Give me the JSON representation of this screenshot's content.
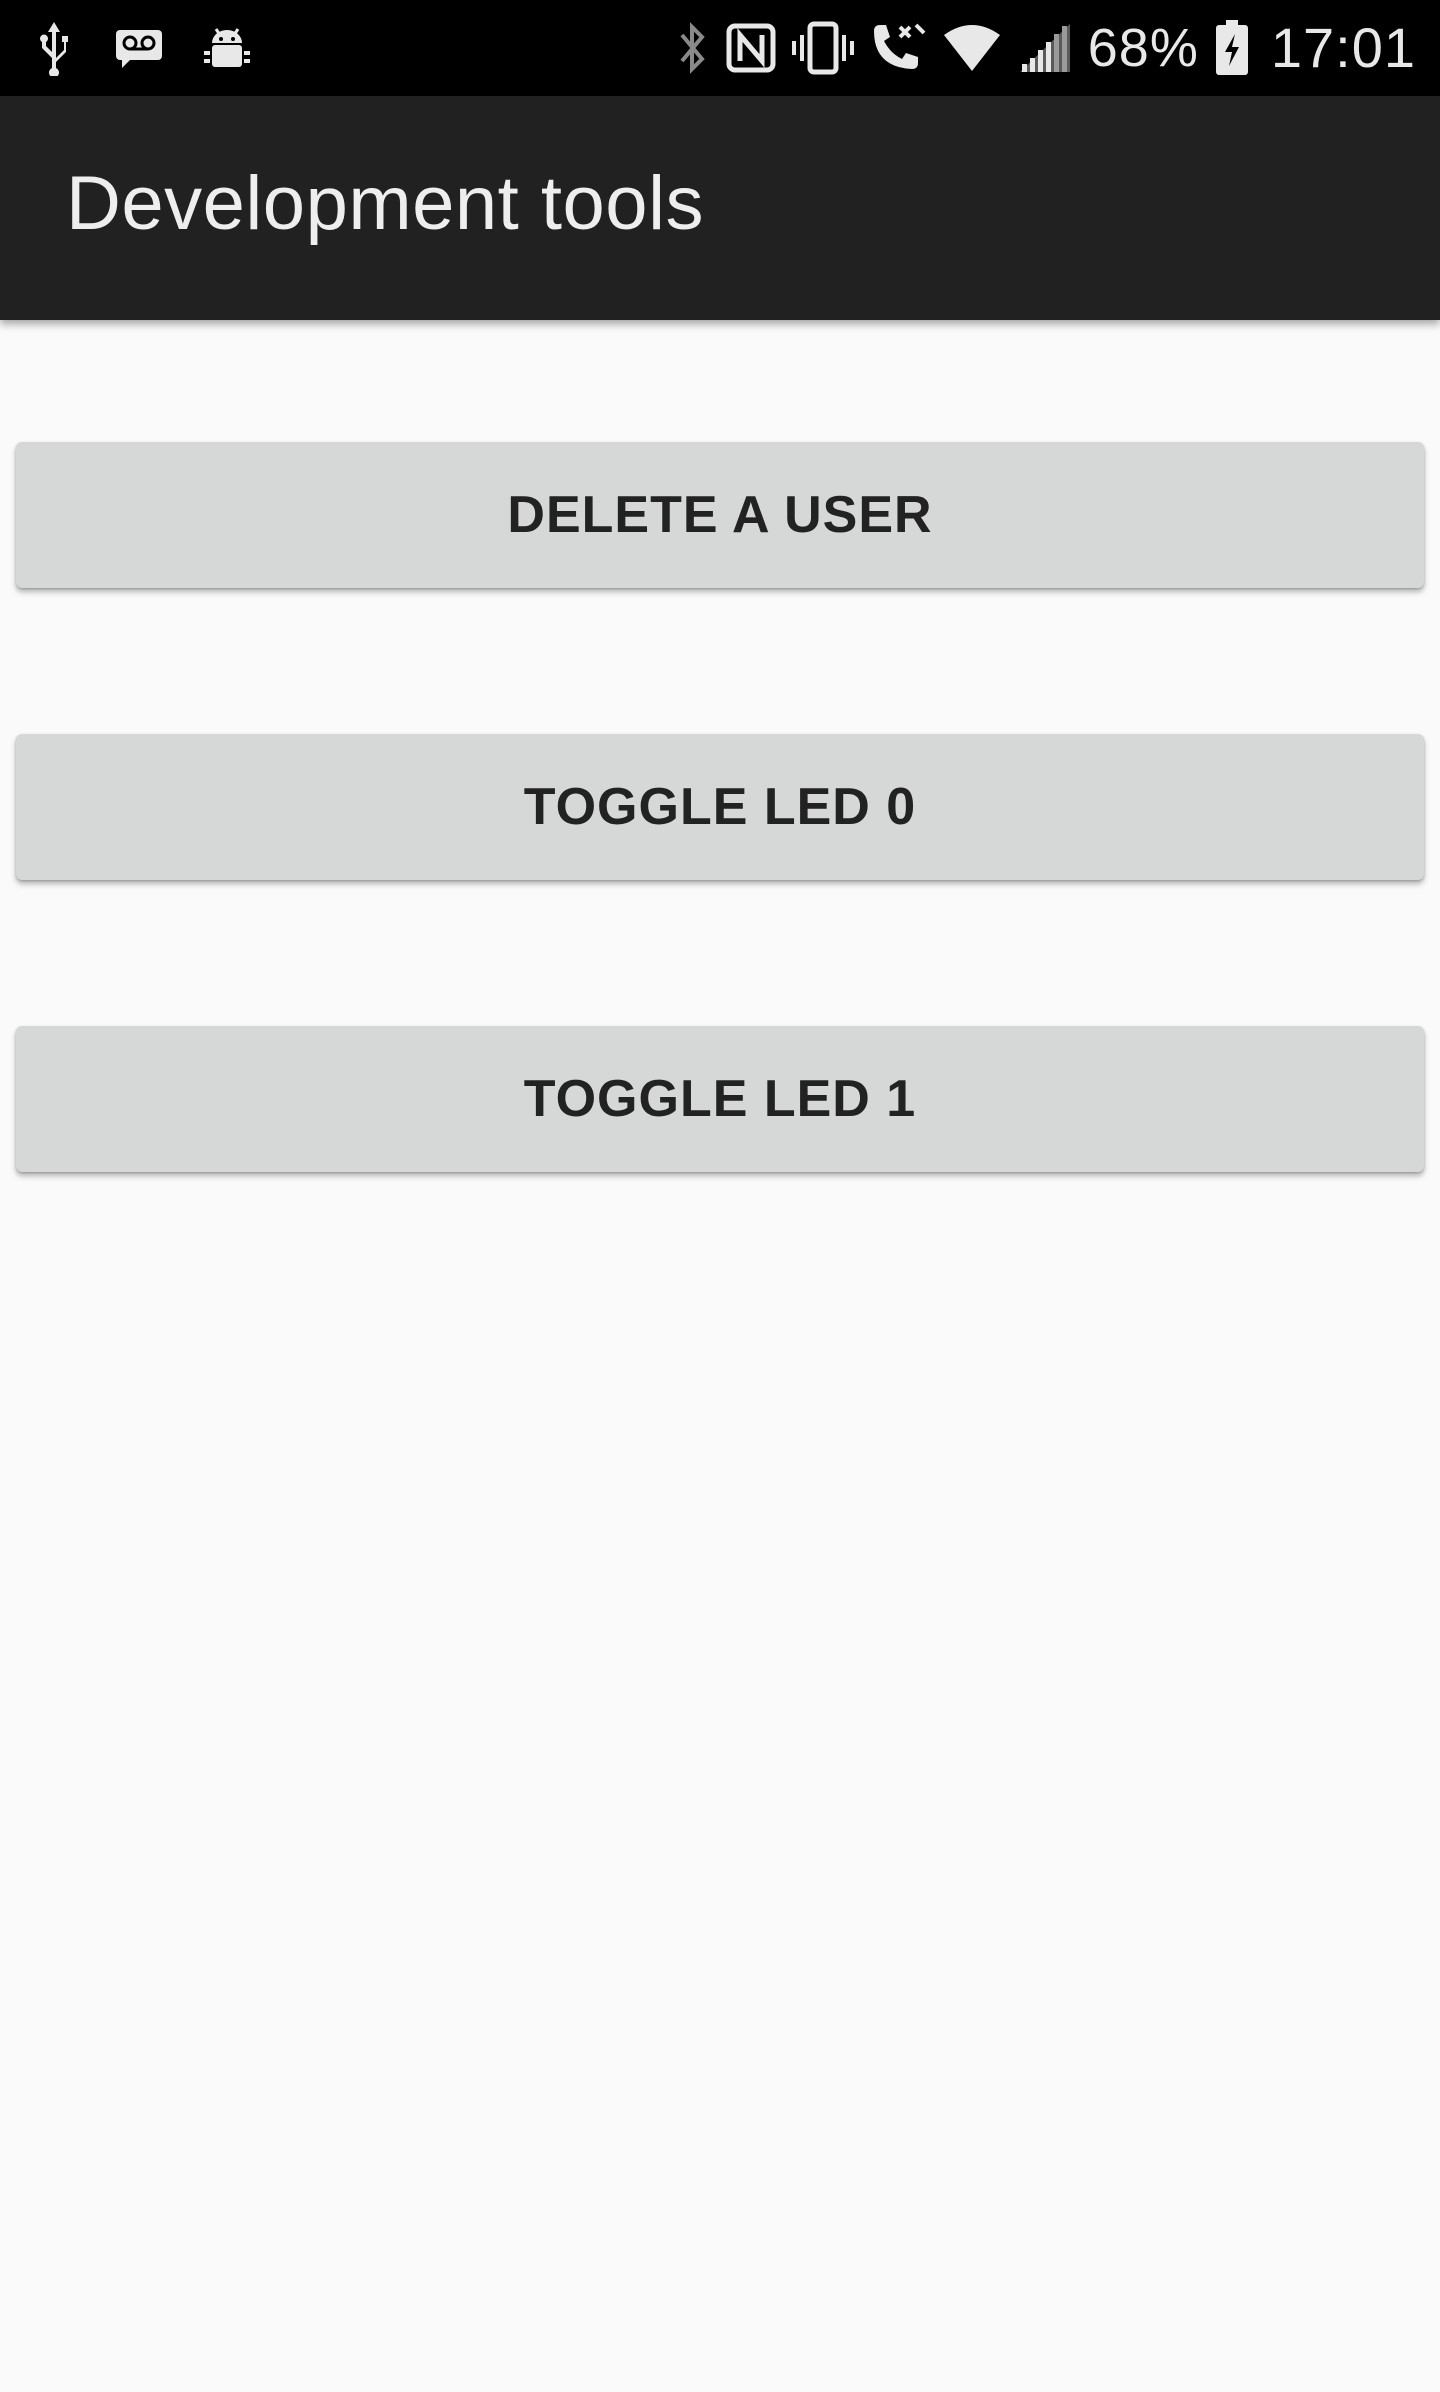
{
  "status_bar": {
    "left_icons": [
      "usb-icon",
      "voicemail-icon",
      "android-debug-icon"
    ],
    "right_icons": [
      "bluetooth-icon",
      "nfc-icon",
      "vibrate-icon",
      "wifi-calling-icon",
      "wifi-icon",
      "signal-icon",
      "battery-charging-icon"
    ],
    "battery_percent": "68%",
    "time": "17:01"
  },
  "app_bar": {
    "title": "Development tools"
  },
  "buttons": [
    {
      "label": "DELETE A USER"
    },
    {
      "label": "TOGGLE LED 0"
    },
    {
      "label": "TOGGLE LED 1"
    }
  ],
  "colors": {
    "status_bar_bg": "#000000",
    "app_bar_bg": "#212121",
    "page_bg": "#fafafa",
    "button_bg": "#d6d7d7",
    "button_text": "#222222"
  }
}
